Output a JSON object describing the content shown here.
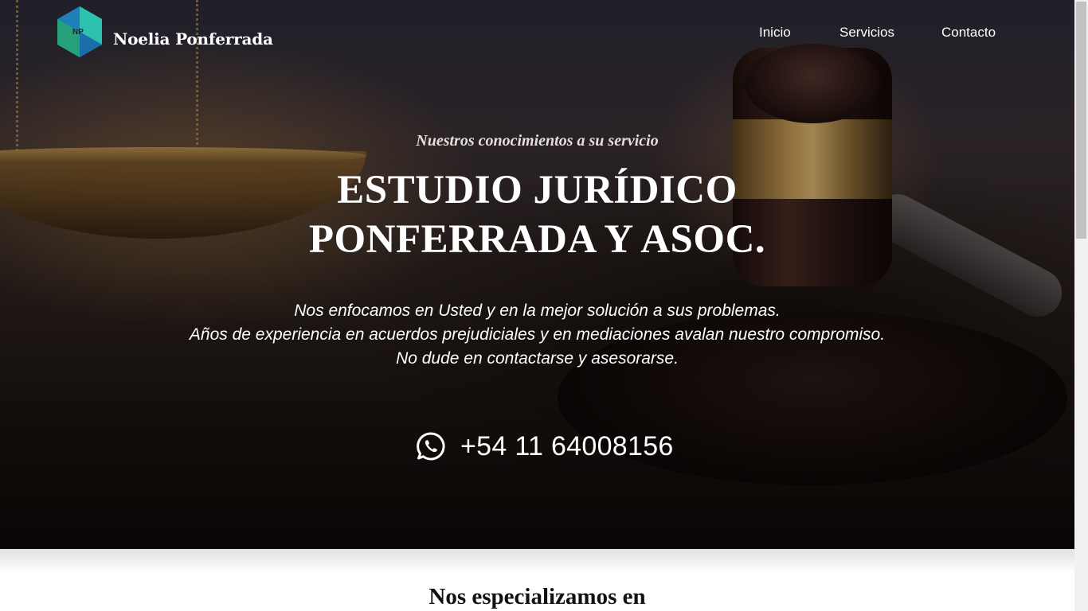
{
  "header": {
    "logo_text": "NP",
    "brand_name": "Noelia Ponferrada",
    "nav": {
      "inicio": "Inicio",
      "servicios": "Servicios",
      "contacto": "Contacto"
    }
  },
  "hero": {
    "tagline": "Nuestros conocimientos a su servicio",
    "title_line1": "ESTUDIO JURÍDICO",
    "title_line2": "PONFERRADA Y ASOC.",
    "description": [
      "Nos enfocamos en Usted y en la mejor solución a sus problemas.",
      "Años de experiencia en acuerdos prejudiciales y en mediaciones avalan nuestro compromiso.",
      "No dude en contactarse y asesorarse."
    ],
    "phone": "+54 11 64008156",
    "phone_icon": "whatsapp-icon"
  },
  "services": {
    "title": "Nos especializamos en"
  },
  "colors": {
    "logo_teal": "#2bb3a8",
    "logo_blue": "#1f7fb8",
    "text_light": "#ffffff"
  }
}
